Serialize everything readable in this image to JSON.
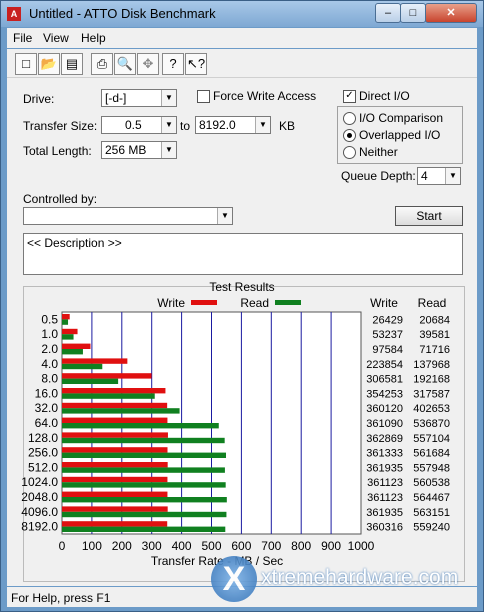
{
  "window": {
    "title": "Untitled - ATTO Disk Benchmark"
  },
  "menu": [
    "File",
    "View",
    "Help"
  ],
  "toolbar_icons": [
    "new-icon",
    "open-icon",
    "save-icon",
    "print-icon",
    "print-preview-icon",
    "move-icon",
    "help-icon",
    "context-help-icon"
  ],
  "form": {
    "drive_label": "Drive:",
    "drive_value": "[-d-]",
    "force_write_label": "Force Write Access",
    "force_write_checked": false,
    "direct_io_label": "Direct I/O",
    "direct_io_checked": true,
    "transfer_size_label": "Transfer Size:",
    "transfer_from": "0.5",
    "to_label": "to",
    "transfer_to": "8192.0",
    "kb_label": "KB",
    "total_length_label": "Total Length:",
    "total_length_value": "256 MB",
    "io_options": [
      {
        "label": "I/O Comparison",
        "selected": false
      },
      {
        "label": "Overlapped I/O",
        "selected": true
      },
      {
        "label": "Neither",
        "selected": false
      }
    ],
    "queue_depth_label": "Queue Depth:",
    "queue_depth_value": "4",
    "controlled_by_label": "Controlled by:",
    "controlled_by_value": "",
    "start_button": "Start",
    "description": "<< Description >>"
  },
  "results": {
    "title": "Test Results",
    "write_legend": "Write",
    "read_legend": "Read",
    "write_col": "Write",
    "read_col": "Read",
    "xlabel": "Transfer Rate - MB / Sec",
    "colors": {
      "write": "#e01010",
      "read": "#108020"
    }
  },
  "chart_data": {
    "type": "bar",
    "orientation": "horizontal",
    "title": "Test Results",
    "xlabel": "Transfer Rate - MB / Sec",
    "xlim": [
      0,
      1000
    ],
    "xticks": [
      0,
      100,
      200,
      300,
      400,
      500,
      600,
      700,
      800,
      900,
      1000
    ],
    "categories": [
      "0.5",
      "1.0",
      "2.0",
      "4.0",
      "8.0",
      "16.0",
      "32.0",
      "64.0",
      "128.0",
      "256.0",
      "512.0",
      "1024.0",
      "2048.0",
      "4096.0",
      "8192.0"
    ],
    "series": [
      {
        "name": "Write",
        "values": [
          26429,
          53237,
          97584,
          223854,
          306581,
          354253,
          360120,
          361090,
          362869,
          361333,
          361935,
          361123,
          361123,
          361935,
          360316
        ]
      },
      {
        "name": "Read",
        "values": [
          20684,
          39581,
          71716,
          137968,
          192168,
          317587,
          402653,
          536870,
          557104,
          561684,
          557948,
          560538,
          564467,
          563151,
          559240
        ]
      }
    ],
    "grid": true,
    "legend": "top"
  },
  "status": {
    "text": "For Help, press F1"
  },
  "watermark": "xtremehardware.com"
}
